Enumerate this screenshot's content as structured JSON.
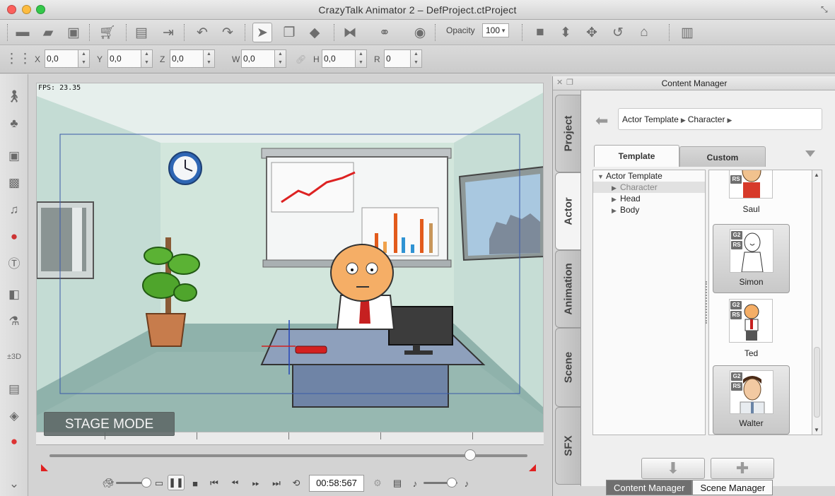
{
  "window": {
    "title": "CrazyTalk Animator 2    – DefProject.ctProject"
  },
  "toolbar": {
    "opacity_label": "Opacity",
    "opacity_value": "100",
    "icons": [
      "new-file",
      "open-folder",
      "save",
      "cart",
      "preview",
      "export",
      "undo",
      "redo",
      "select",
      "duplicate",
      "transform",
      "flip",
      "link",
      "visibility",
      "camera",
      "move-up-down",
      "move",
      "rotate",
      "home",
      "align"
    ]
  },
  "transform": {
    "x_label": "X",
    "x_value": "0,0",
    "y_label": "Y",
    "y_value": "0,0",
    "z_label": "Z",
    "z_value": "0,0",
    "w_label": "W",
    "w_value": "0,0",
    "h_label": "H",
    "h_value": "0,0",
    "r_label": "R",
    "r_value": "0"
  },
  "stage": {
    "fps": "FPS: 23.35",
    "mode_label": "STAGE MODE"
  },
  "playback": {
    "timecode": "00:58:567",
    "timeline_position": 0.88
  },
  "content_manager": {
    "title": "Content Manager",
    "side_tabs": [
      "Project",
      "Actor",
      "Animation",
      "Scene",
      "SFX"
    ],
    "active_side_tab": "Actor",
    "breadcrumb": [
      "Actor Template",
      "Character"
    ],
    "tabs": {
      "template": "Template",
      "custom": "Custom"
    },
    "tree": [
      {
        "label": "Actor Template",
        "level": 0,
        "expanded": true
      },
      {
        "label": "Character",
        "level": 1,
        "selected": true
      },
      {
        "label": "Head",
        "level": 1
      },
      {
        "label": "Body",
        "level": 1
      }
    ],
    "thumbnails": [
      {
        "name": "Saul",
        "badges": [
          "RS"
        ]
      },
      {
        "name": "Simon",
        "badges": [
          "G2",
          "RS"
        ],
        "selected": true
      },
      {
        "name": "Ted",
        "badges": [
          "G2",
          "RS"
        ]
      },
      {
        "name": "Walter",
        "badges": [
          "G2",
          "RS"
        ],
        "selected": true
      }
    ]
  },
  "bottom_tabs": {
    "content_manager": "Content Manager",
    "scene_manager": "Scene Manager"
  },
  "colors": {
    "accent_red": "#e02020",
    "stage_wall": "#c5dbd3",
    "stage_floor": "#8fb2ab"
  }
}
